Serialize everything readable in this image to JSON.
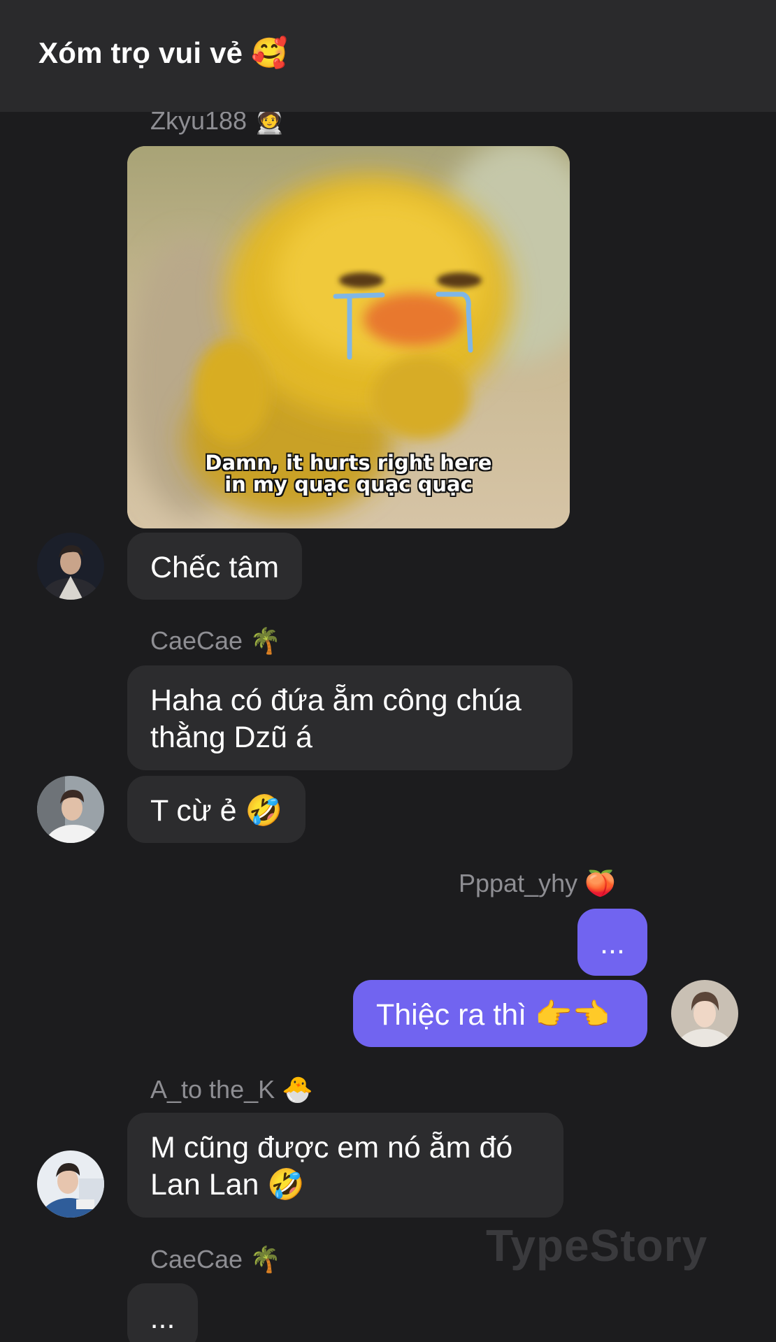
{
  "chat": {
    "title": "Xóm trọ vui vẻ 🥰"
  },
  "messages": {
    "m1": {
      "sender": "Zkyu188 🧑‍🚀"
    },
    "m1_image": {
      "caption_line1": "Damn, it hurts right here",
      "caption_line2": "in my quạc quạc quạc"
    },
    "m2": {
      "text": "Chếc tâm"
    },
    "m3": {
      "sender": "CaeCae 🌴",
      "text": "Haha có đứa ẵm công chúa thằng Dzũ á"
    },
    "m4": {
      "text": "T cừ ẻ 🤣"
    },
    "m5": {
      "sender": "Pppat_yhy 🍑",
      "text": "..."
    },
    "m6": {
      "text": "Thiệc ra thì 👉👈"
    },
    "m7": {
      "sender": "A_to the_K 🐣",
      "text": "M cũng được em nó ẵm đó Lan Lan 🤣"
    },
    "m8": {
      "sender": "CaeCae 🌴",
      "text": "..."
    }
  },
  "watermark": "TypeStory",
  "colors": {
    "background": "#1c1c1e",
    "header": "#2a2a2c",
    "incoming_bubble": "#2c2c2e",
    "outgoing_bubble": "#7164f0",
    "sender_name": "#8e8e93"
  }
}
